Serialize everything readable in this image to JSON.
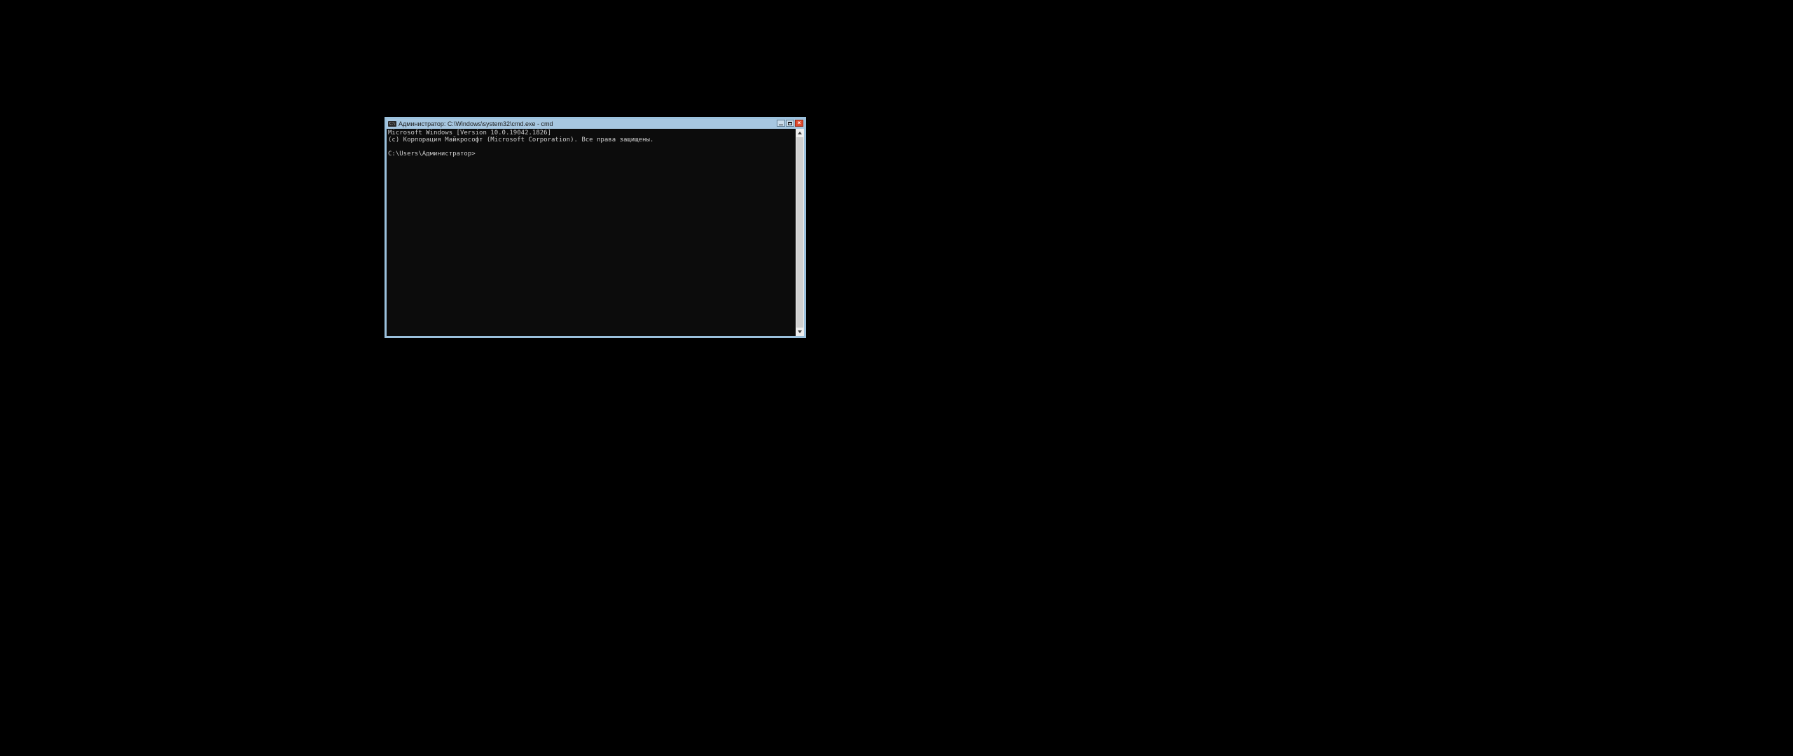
{
  "window": {
    "title": "Администратор: C:\\Windows\\system32\\cmd.exe - cmd",
    "icon_label": "C:\\"
  },
  "console": {
    "line1": "Microsoft Windows [Version 10.0.19042.1826]",
    "line2": "(c) Корпорация Майкрософт (Microsoft Corporation). Все права защищены.",
    "blank": "",
    "prompt": "C:\\Users\\Администратор>"
  },
  "controls": {
    "minimize": "Minimize",
    "maximize": "Maximize",
    "close": "Close"
  },
  "scrollbar": {
    "up": "Scroll up",
    "down": "Scroll down"
  }
}
